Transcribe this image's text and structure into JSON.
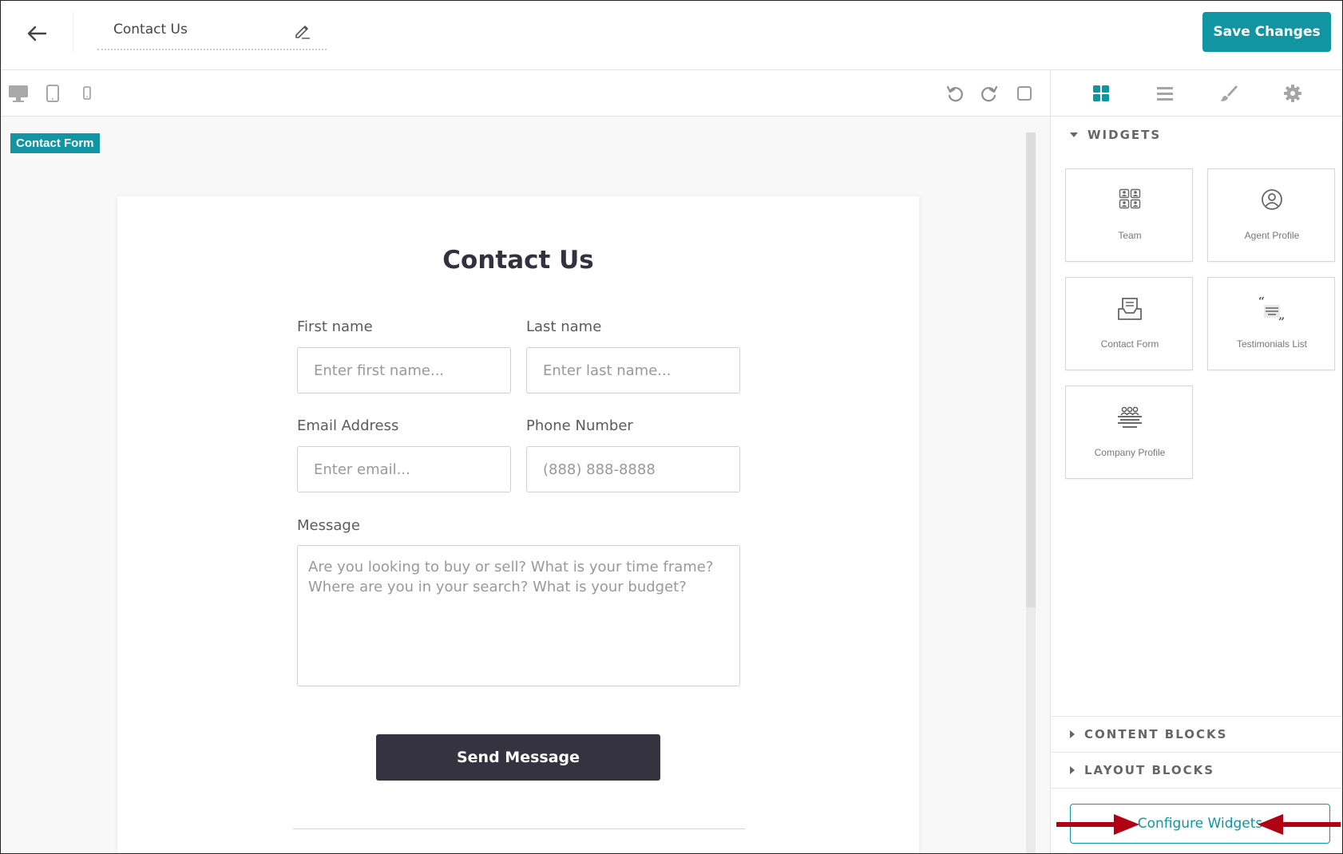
{
  "header": {
    "page_name": "Contact Us",
    "save_label": "Save Changes",
    "accent_color": "#1195a3"
  },
  "toolbar": {
    "device_icons": [
      "desktop-icon",
      "tablet-icon",
      "mobile-icon"
    ],
    "action_icons": [
      "undo-icon",
      "redo-icon",
      "fullscreen-icon"
    ]
  },
  "canvas": {
    "selected_tag": "Contact Form",
    "form": {
      "title": "Contact Us",
      "first_name": {
        "label": "First name",
        "placeholder": "Enter first name..."
      },
      "last_name": {
        "label": "Last name",
        "placeholder": "Enter last name..."
      },
      "email": {
        "label": "Email Address",
        "placeholder": "Enter email..."
      },
      "phone": {
        "label": "Phone Number",
        "placeholder": "(888) 888-8888"
      },
      "message": {
        "label": "Message",
        "placeholder": "Are you looking to buy or sell? What is your time frame? Where are you in your search? What is your budget?"
      },
      "submit_label": "Send Message"
    }
  },
  "panel": {
    "tabs": [
      "widgets-icon",
      "layers-icon",
      "brush-icon",
      "settings-icon"
    ],
    "widgets_heading": "WIDGETS",
    "widgets": [
      {
        "label": "Team",
        "icon": "team-icon"
      },
      {
        "label": "Agent Profile",
        "icon": "agent-profile-icon"
      },
      {
        "label": "Contact Form",
        "icon": "contact-form-icon"
      },
      {
        "label": "Testimonials List",
        "icon": "testimonials-icon"
      },
      {
        "label": "Company Profile",
        "icon": "company-profile-icon"
      }
    ],
    "content_blocks_heading": "CONTENT BLOCKS",
    "layout_blocks_heading": "LAYOUT BLOCKS",
    "configure_label": "Configure Widgets",
    "annotation_color": "#b00012"
  }
}
